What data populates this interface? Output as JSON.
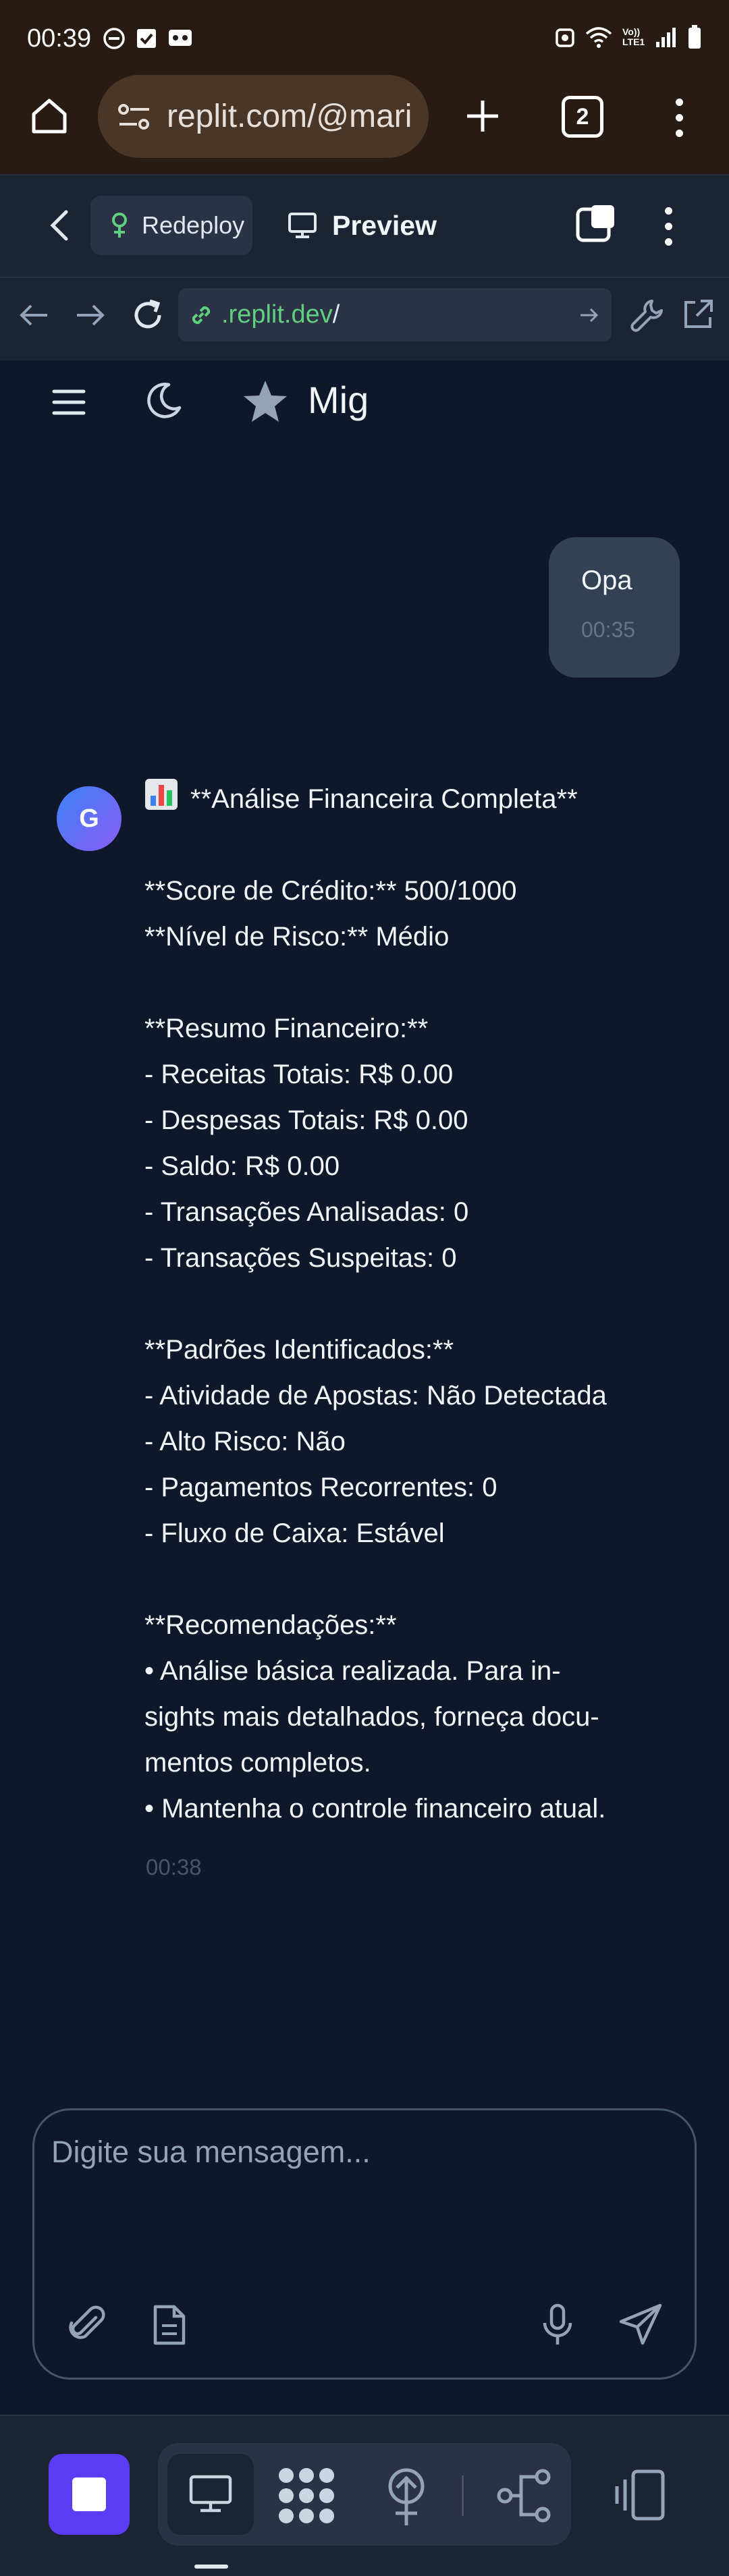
{
  "status_bar": {
    "time": "00:39",
    "icons_left": [
      "dnd-icon",
      "checkbox-notification-icon",
      "messenger-icon"
    ],
    "icons_right": [
      "alarm-icon",
      "wifi-icon",
      "volte-signal-icon",
      "signal-bars-icon",
      "battery-icon"
    ],
    "volte_label": "Vo)) LTE1"
  },
  "browser": {
    "address": "replit.com/@mari",
    "tab_count": "2"
  },
  "replit_toolbar": {
    "redeploy_label": "Redeploy",
    "preview_label": "Preview"
  },
  "webview": {
    "url_domain": ".replit.dev",
    "url_path": "/"
  },
  "app": {
    "title": "Mig"
  },
  "chat": {
    "user_message": {
      "text": "Opa",
      "time": "00:35"
    },
    "bot_message": {
      "avatar_letter": "G",
      "lines": [
        "**Análise Financeira Completa**",
        "",
        "**Score de Crédito:** 500/1000",
        "**Nível de Risco:** Médio",
        "",
        "**Resumo Financeiro:**",
        "- Receitas Totais: R$ 0.00",
        "- Despesas Totais: R$ 0.00",
        "- Saldo: R$ 0.00",
        "- Transações Analisadas: 0",
        "- Transações Suspeitas: 0",
        "",
        "**Padrões Identificados:**",
        "- Atividade de Apostas: Não Detectada",
        "- Alto Risco: Não",
        "- Pagamentos Recorrentes: 0",
        "- Fluxo de Caixa: Estável",
        "",
        "**Recomendações:**",
        "• Análise básica realizada. Para in-",
        "sights mais detalhados, forneça docu-",
        "mentos completos.",
        "• Mantenha o controle financeiro atual."
      ],
      "time": "00:38"
    }
  },
  "composer": {
    "placeholder": "Digite sua mensagem..."
  },
  "colors": {
    "background": "#0f172a",
    "browser_chrome": "#271b14",
    "replit_bar": "#1c2333",
    "user_bubble": "#334155",
    "url_green": "#5fcf80",
    "stop_button": "#5b3df5"
  }
}
